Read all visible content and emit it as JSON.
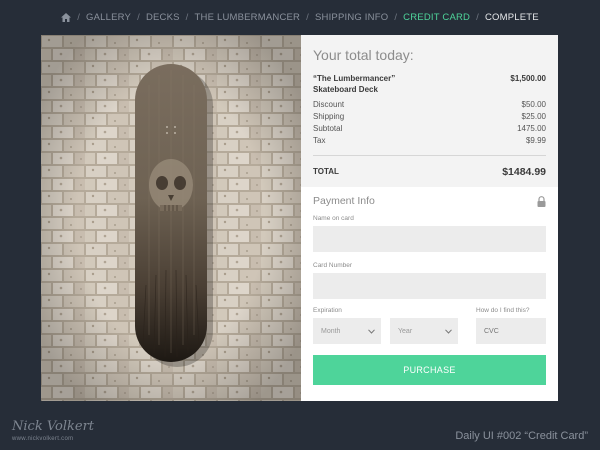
{
  "breadcrumb": {
    "home_icon": "home-icon",
    "items": [
      "GALLERY",
      "DECKS",
      "THE LUMBERMANCER",
      "SHIPPING INFO",
      "CREDIT CARD",
      "COMPLETE"
    ],
    "separator": "/",
    "active_color": "#4ed49a"
  },
  "summary": {
    "title": "Your total today:",
    "product_name": "“The Lumbermancer” Skateboard Deck",
    "product_price": "$1,500.00",
    "lines": [
      {
        "label": "Discount",
        "value": "$50.00"
      },
      {
        "label": "Shipping",
        "value": "$25.00"
      },
      {
        "label": "Subtotal",
        "value": "1475.00"
      },
      {
        "label": "Tax",
        "value": "$9.99"
      }
    ],
    "total_label": "TOTAL",
    "total_value": "$1484.99"
  },
  "payment": {
    "title": "Payment Info",
    "lock_icon": "lock-icon",
    "name_label": "Name on card",
    "card_label": "Card Number",
    "expiration_label": "Expiration",
    "month_value": "Month",
    "year_value": "Year",
    "cvc_help": "How do I find this?",
    "cvc_placeholder": "CVC",
    "purchase_label": "PURCHASE"
  },
  "footer": {
    "signature_url": "www.nickvolkert.com",
    "label": "Daily UI #002 “Credit Card”"
  },
  "colors": {
    "background": "#262d38",
    "accent": "#4ed49a"
  }
}
